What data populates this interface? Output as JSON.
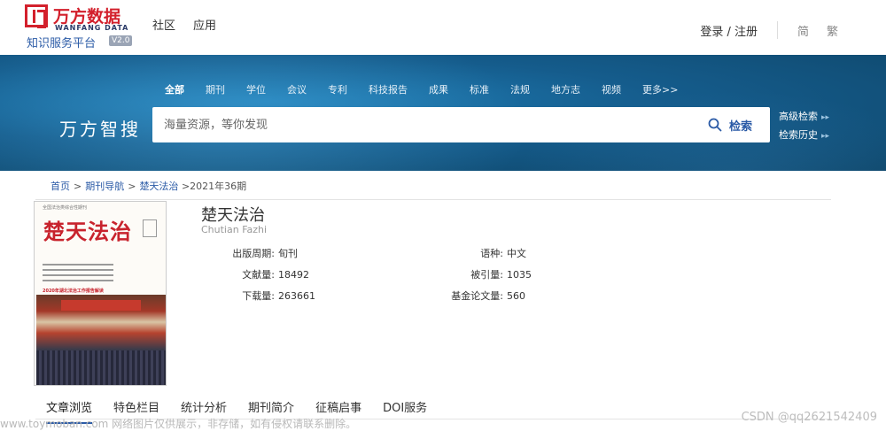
{
  "header": {
    "logo": {
      "cn": "万方数据",
      "en": "WANFANG DATA",
      "subtitle": "知识服务平台",
      "version": "V2.0"
    },
    "nav": [
      "社区",
      "应用"
    ],
    "login": "登录 / 注册",
    "lang_simplified": "简",
    "lang_traditional": "繁"
  },
  "search": {
    "categories": [
      {
        "label": "全部",
        "active": true
      },
      {
        "label": "期刊"
      },
      {
        "label": "学位"
      },
      {
        "label": "会议"
      },
      {
        "label": "专利"
      },
      {
        "label": "科技报告"
      },
      {
        "label": "成果"
      },
      {
        "label": "标准"
      },
      {
        "label": "法规"
      },
      {
        "label": "地方志"
      },
      {
        "label": "视频"
      },
      {
        "label": "更多>>"
      }
    ],
    "brand": "万方智搜",
    "placeholder": "海量资源，等你发现",
    "button": "检索",
    "advanced": "高级检索",
    "history": "检索历史"
  },
  "breadcrumb": {
    "home": "首页",
    "journals": "期刊导航",
    "journal": "楚天法治",
    "current": ">2021年36期"
  },
  "cover": {
    "header": "全国法治类综合性期刊",
    "title": "楚天法治",
    "headline": "2020年湖北法治工作报告解读"
  },
  "journal": {
    "title": "楚天法治",
    "pinyin": "Chutian Fazhi",
    "fields": {
      "period_label": "出版周期:",
      "period_value": "旬刊",
      "language_label": "语种:",
      "language_value": "中文",
      "articles_label": "文献量:",
      "articles_value": "18492",
      "cited_label": "被引量:",
      "cited_value": "1035",
      "downloads_label": "下载量:",
      "downloads_value": "263661",
      "fund_label": "基金论文量:",
      "fund_value": "560"
    }
  },
  "tabs": [
    "文章浏览",
    "特色栏目",
    "统计分析",
    "期刊简介",
    "征稿启事",
    "DOI服务"
  ],
  "watermarks": {
    "left": "www.toymoban.com 网络图片仅供展示，非存储，如有侵权请联系删除。",
    "right": "CSDN @qq2621542409"
  },
  "colors": {
    "brand_red": "#d3202c",
    "link_blue": "#2a5aa6",
    "banner_blue": "#155c8c"
  }
}
